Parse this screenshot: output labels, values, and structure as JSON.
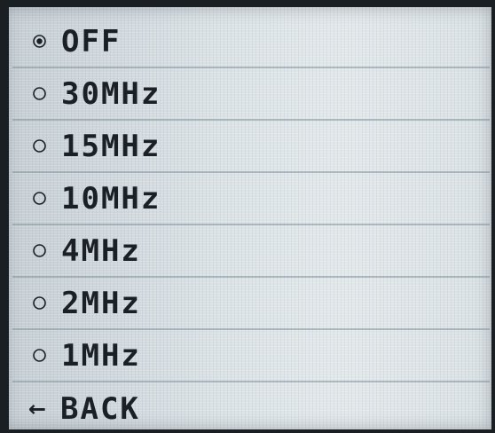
{
  "menu": {
    "options": [
      {
        "label": "OFF",
        "selected": true
      },
      {
        "label": "30MHz",
        "selected": false
      },
      {
        "label": "15MHz",
        "selected": false
      },
      {
        "label": "10MHz",
        "selected": false
      },
      {
        "label": "4MHz",
        "selected": false
      },
      {
        "label": "2MHz",
        "selected": false
      },
      {
        "label": "1MHz",
        "selected": false
      }
    ],
    "back": {
      "icon": "left-arrow-icon",
      "glyph": "←",
      "label": "BACK"
    }
  },
  "colors": {
    "text": "#1b2026",
    "screen": "#d2dadf",
    "bezel": "#1a1f24",
    "divider": "#8291a0"
  }
}
